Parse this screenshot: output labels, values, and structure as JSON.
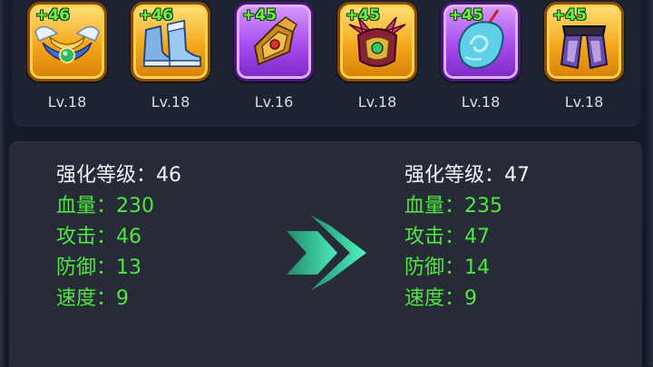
{
  "equipment": [
    {
      "plus": "+46",
      "level": "Lv.18",
      "rarity": "gold",
      "icon": "winged-necklace-icon"
    },
    {
      "plus": "+46",
      "level": "Lv.18",
      "rarity": "gold",
      "icon": "boots-icon"
    },
    {
      "plus": "+45",
      "level": "Lv.16",
      "rarity": "purple",
      "icon": "bracer-icon"
    },
    {
      "plus": "+45",
      "level": "Lv.18",
      "rarity": "gold",
      "icon": "helmet-icon"
    },
    {
      "plus": "+45",
      "level": "Lv.18",
      "rarity": "purple",
      "icon": "jade-pendant-icon"
    },
    {
      "plus": "+45",
      "level": "Lv.18",
      "rarity": "gold",
      "icon": "leg-armor-icon"
    }
  ],
  "stats": {
    "separator": "：",
    "current": {
      "enhance_label": "强化等级",
      "enhance_value": "46",
      "hp_label": "血量",
      "hp_value": "230",
      "atk_label": "攻击",
      "atk_value": "46",
      "def_label": "防御",
      "def_value": "13",
      "spd_label": "速度",
      "spd_value": "9"
    },
    "next": {
      "enhance_label": "强化等级",
      "enhance_value": "47",
      "hp_label": "血量",
      "hp_value": "235",
      "atk_label": "攻击",
      "atk_value": "47",
      "def_label": "防御",
      "def_value": "14",
      "spd_label": "速度",
      "spd_value": "9"
    }
  },
  "colors": {
    "attribute_text": "#4ee83d",
    "level_text": "#f2f2f2",
    "plus_badge": "#6bf04a",
    "gold_frame": "#f4a71a",
    "purple_frame": "#a64bee",
    "arrow": "#2fe6a4"
  }
}
